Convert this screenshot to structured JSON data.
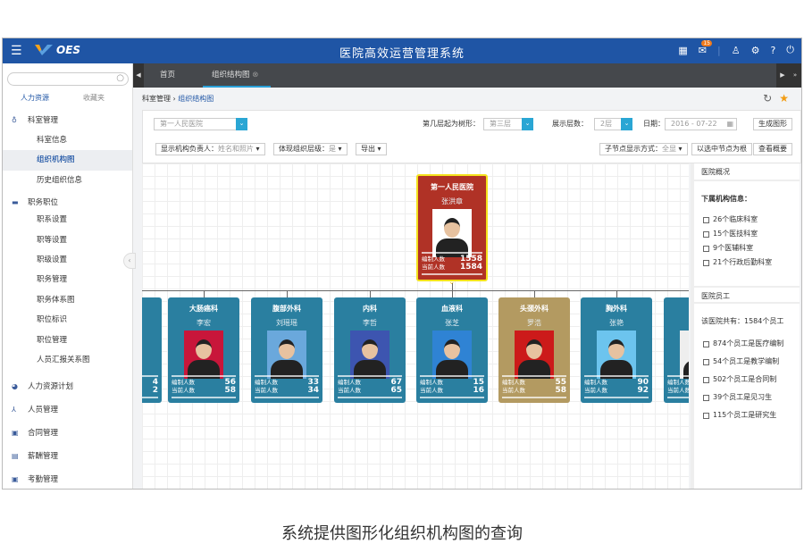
{
  "header": {
    "logo": "OES",
    "title": "医院高效运营管理系统",
    "message_count": "15"
  },
  "sidebar": {
    "tabs": [
      "人力资源",
      "收藏夹"
    ],
    "groups": [
      {
        "label": "科室管理",
        "icon": "money-bag-icon",
        "items": [
          "科室信息",
          "组织机构图",
          "历史组织信息"
        ]
      },
      {
        "label": "职务职位",
        "icon": "briefcase-icon",
        "items": [
          "职系设置",
          "职等设置",
          "职级设置",
          "职务管理",
          "职务体系图",
          "职位标识",
          "职位管理",
          "人员汇报关系图"
        ]
      },
      {
        "label": "人力资源计划",
        "icon": "pie-chart-icon",
        "items": []
      },
      {
        "label": "人员管理",
        "icon": "people-icon",
        "items": []
      },
      {
        "label": "合同管理",
        "icon": "contract-icon",
        "items": []
      },
      {
        "label": "薪酬管理",
        "icon": "salary-icon",
        "items": []
      },
      {
        "label": "考勤管理",
        "icon": "attendance-icon",
        "items": []
      }
    ],
    "active": "组织机构图"
  },
  "tabs": [
    "首页",
    "组织结构图"
  ],
  "breadcrumb": [
    "科室管理",
    "组织结构图"
  ],
  "toolbar": {
    "org_select": "第一人民医院",
    "tree_from_label": "第几层起为树形：",
    "tree_from": "第三层",
    "levels_label": "展示层数：",
    "levels": "2层",
    "date_label": "日期：",
    "date": "2016 - 07-22",
    "generate": "生成图形",
    "show_leader_label": "显示机构负责人：",
    "show_leader": "姓名和照片",
    "show_level_label": "体现组织层级：",
    "show_level": "是",
    "export": "导出",
    "child_mode_label": "子节点显示方式：",
    "child_mode": "全显",
    "set_root": "以选中节点为根",
    "view_summary": "查看概要"
  },
  "org": {
    "stat_labels": [
      "编制人数",
      "当前人数"
    ],
    "root": {
      "name": "第一人民医院",
      "head": "张洪章",
      "quota": "1558",
      "current": "1584"
    },
    "children": [
      {
        "name": "",
        "head": "",
        "quota": "4",
        "current": "2",
        "partial": true
      },
      {
        "name": "大肠癌科",
        "head": "李宏",
        "quota": "56",
        "current": "58"
      },
      {
        "name": "腹部外科",
        "head": "刘瑶瑶",
        "quota": "33",
        "current": "34"
      },
      {
        "name": "内科",
        "head": "李哲",
        "quota": "67",
        "current": "65"
      },
      {
        "name": "血液科",
        "head": "张芝",
        "quota": "15",
        "current": "16"
      },
      {
        "name": "头颈外科",
        "head": "罗浩",
        "quota": "55",
        "current": "58",
        "highlight": true
      },
      {
        "name": "胸外科",
        "head": "张艳",
        "quota": "90",
        "current": "92"
      },
      {
        "name": "骨",
        "head": "",
        "quota": "",
        "current": "",
        "partial": true
      }
    ]
  },
  "colors": {
    "header": "#1f55a5",
    "card": "#2a7fa0",
    "card_alt": "#b39a61",
    "root": "#b03226"
  },
  "summary": {
    "title": "医院概况",
    "sub_title": "下属机构信息：",
    "units": [
      "26个临床科室",
      "15个医技科室",
      "9个医辅科室",
      "21个行政后勤科室"
    ],
    "staff_title": "医院员工",
    "staff_total": "该医院共有：1584个员工",
    "staff": [
      "874个员工是医疗编制",
      "54个员工是教学编制",
      "502个员工是合同制",
      "39个员工是见习生",
      "115个员工是研究生"
    ]
  },
  "caption": "系统提供图形化组织机构图的查询"
}
